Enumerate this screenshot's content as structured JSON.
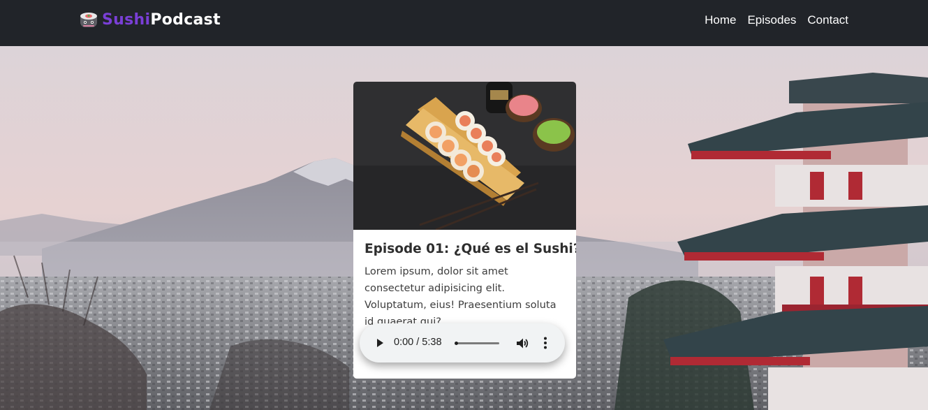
{
  "brand": {
    "name_part1": "Sushi",
    "name_part2": "Podcast",
    "colors": {
      "navbar": "#212429",
      "accent": "#7a3fd6"
    }
  },
  "nav": {
    "links": [
      "Home",
      "Episodes",
      "Contact"
    ]
  },
  "episode": {
    "title": "Episode 01: ¿Qué es el Sushi?",
    "description": "Lorem ipsum, dolor sit amet consectetur adipisicing elit. Voluptatum, eius! Praesentium soluta id quaerat qui?",
    "image": "sushi-rolls-on-wooden-board",
    "player": {
      "time": "0:00 / 5:38",
      "progress": 0.0
    }
  }
}
